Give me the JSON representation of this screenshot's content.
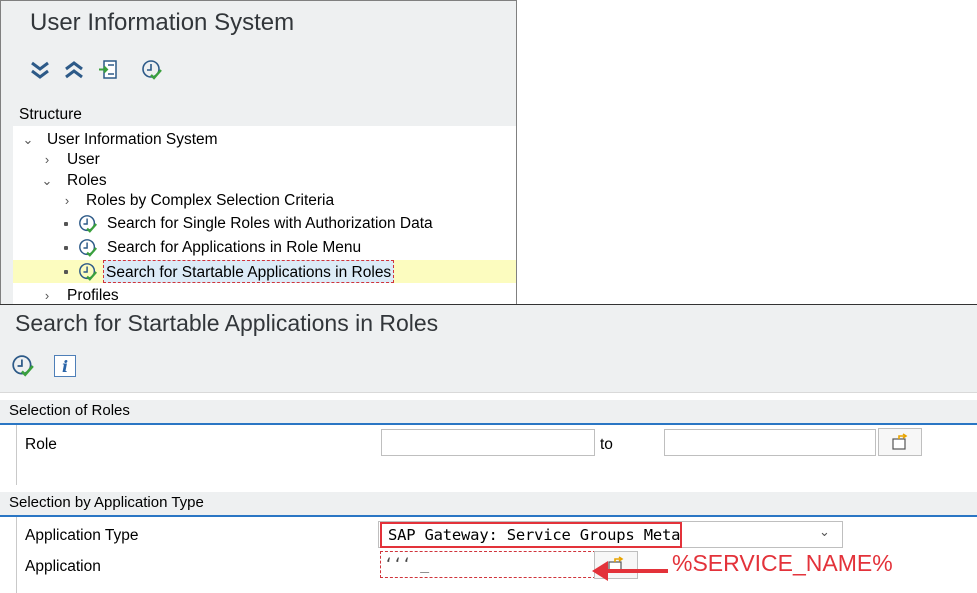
{
  "top_window": {
    "title": "User Information System",
    "toolbar": [
      "expand-all-icon",
      "collapse-all-icon",
      "find-in-tree-icon",
      "execute-icon"
    ],
    "tree": {
      "header": "Structure",
      "items": [
        {
          "label": "User Information System",
          "chev": "⌄",
          "level": 0
        },
        {
          "label": "User",
          "chev": "›",
          "level": 1
        },
        {
          "label": "Roles",
          "chev": "⌄",
          "level": 1
        },
        {
          "label": "Roles by Complex Selection Criteria",
          "chev": "›",
          "level": 2
        },
        {
          "label": "Search for Single Roles with Authorization Data",
          "level": 2
        },
        {
          "label": "Search for Applications in Role Menu",
          "level": 2
        },
        {
          "label": "Search for Startable Applications in Roles",
          "level": 2,
          "selected": true
        },
        {
          "label": "Profiles",
          "chev": "›",
          "level": 1
        }
      ]
    }
  },
  "bottom_window": {
    "title": "Search for Startable Applications in Roles",
    "toolbar": [
      "execute-icon",
      "info-icon"
    ],
    "info_glyph": "i",
    "selection_roles": {
      "title": "Selection of Roles",
      "role_label": "Role",
      "role_from": "",
      "to_label": "to",
      "role_to": ""
    },
    "selection_app": {
      "title": "Selection by Application Type",
      "app_type_label": "Application Type",
      "app_type_value": "SAP Gateway: Service Groups Metadata",
      "app_label": "Application",
      "app_value": "‘‘‘ _ "
    }
  },
  "annotation": {
    "text": "%SERVICE_NAME%",
    "color": "#e3323a"
  },
  "colors": {
    "accent_blue": "#2a76c4",
    "selected_row": "#fcfcbf",
    "highlight_red": "#e3323a",
    "execute_green": "#3aa03d"
  }
}
